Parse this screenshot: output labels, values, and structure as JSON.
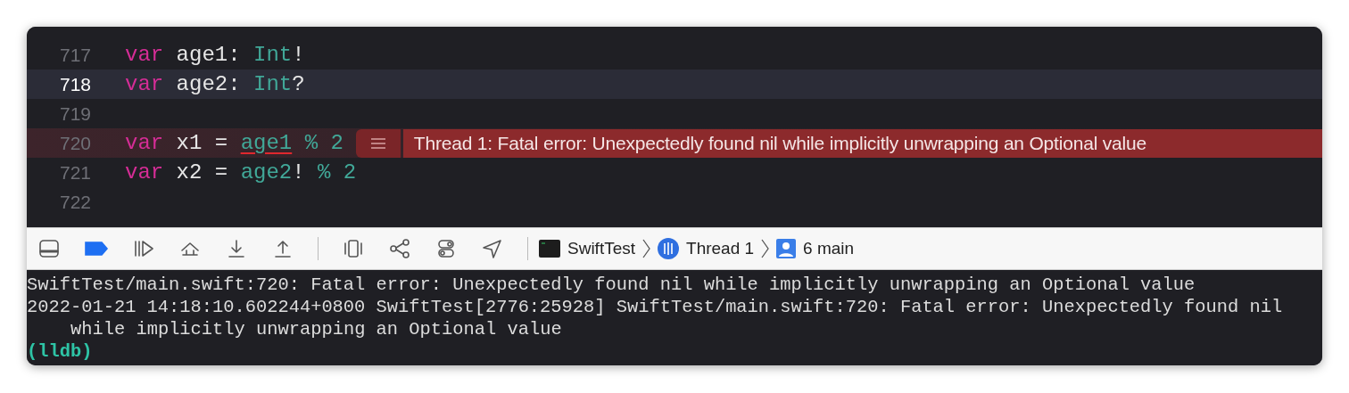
{
  "editor": {
    "lines": [
      {
        "number": "717",
        "current": false,
        "tokens": [
          {
            "text": "var",
            "kind": "keyword",
            "error": false
          },
          {
            "text": " age1: ",
            "kind": "plain",
            "error": false
          },
          {
            "text": "Int",
            "kind": "type",
            "error": false
          },
          {
            "text": "!",
            "kind": "plain",
            "error": false
          }
        ]
      },
      {
        "number": "718",
        "current": true,
        "tokens": [
          {
            "text": "var",
            "kind": "keyword",
            "error": false
          },
          {
            "text": " age2: ",
            "kind": "plain",
            "error": false
          },
          {
            "text": "Int",
            "kind": "type",
            "error": false
          },
          {
            "text": "?",
            "kind": "plain",
            "error": false
          }
        ]
      },
      {
        "number": "719",
        "current": false
      },
      {
        "number": "720",
        "current": false,
        "tokens": [
          {
            "text": "var",
            "kind": "keyword",
            "error": false
          },
          {
            "text": " x1 = ",
            "kind": "plain",
            "error": false
          },
          {
            "text": "age1",
            "kind": "type",
            "error": true
          },
          {
            "text": " % 2",
            "kind": "type",
            "error": false
          }
        ],
        "issue": {
          "message": "Thread 1: Fatal error: Unexpectedly found nil while implicitly unwrapping an Optional value"
        }
      },
      {
        "number": "721",
        "current": false,
        "tokens": [
          {
            "text": "var",
            "kind": "keyword",
            "error": false
          },
          {
            "text": " x2 = ",
            "kind": "plain",
            "error": false
          },
          {
            "text": "age2",
            "kind": "type",
            "error": false
          },
          {
            "text": "! ",
            "kind": "plain",
            "error": false
          },
          {
            "text": "% 2",
            "kind": "type",
            "error": false
          }
        ]
      },
      {
        "number": "722",
        "current": false
      }
    ]
  },
  "debug_bar": {
    "breakpoints_active": true,
    "breadcrumb": [
      {
        "kind": "target",
        "label": "SwiftTest"
      },
      {
        "kind": "thread",
        "label": "Thread 1"
      },
      {
        "kind": "frame",
        "label": "6 main"
      }
    ]
  },
  "console": {
    "lines": [
      {
        "kind": "output",
        "text": "SwiftTest/main.swift:720: Fatal error: Unexpectedly found nil while implicitly unwrapping an Optional value"
      },
      {
        "kind": "output",
        "text": "2022-01-21 14:18:10.602244+0800 SwiftTest[2776:25928] SwiftTest/main.swift:720: Fatal error: Unexpectedly found nil while implicitly unwrapping an Optional value"
      },
      {
        "kind": "prompt",
        "text": "(lldb)"
      }
    ]
  }
}
